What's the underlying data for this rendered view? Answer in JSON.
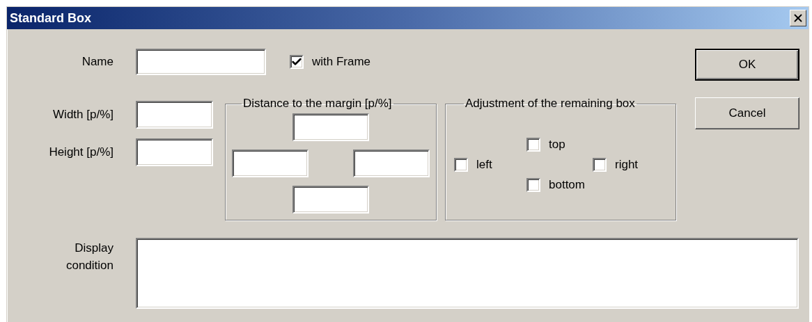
{
  "window": {
    "title": "Standard Box"
  },
  "name_field": {
    "label": "Name"
  },
  "with_frame": {
    "label": "with Frame",
    "checked": true
  },
  "size_fields": [
    {
      "label": "Width [p/%]"
    },
    {
      "label": "Height [p/%]"
    }
  ],
  "distance_group": {
    "title": "Distance to the margin [p/%]"
  },
  "adjustment_group": {
    "title": "Adjustment of the remaining box",
    "options": [
      {
        "label": "left",
        "checked": false
      },
      {
        "label": "top",
        "checked": false
      },
      {
        "label": "right",
        "checked": false
      },
      {
        "label": "bottom",
        "checked": false
      }
    ]
  },
  "buttons": [
    {
      "label": "OK",
      "default": true
    },
    {
      "label": "Cancel",
      "default": false
    }
  ],
  "display_condition": {
    "label": "Display condition"
  }
}
